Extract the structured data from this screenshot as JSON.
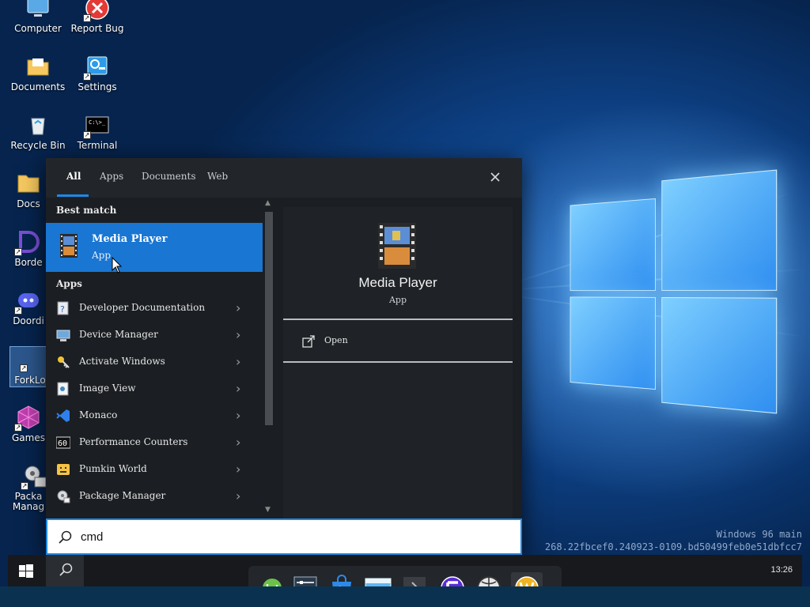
{
  "desktop": {
    "icons": [
      {
        "label": "Computer",
        "icon": "computer-icon"
      },
      {
        "label": "Report Bug",
        "icon": "report-bug-icon"
      },
      {
        "label": "Documents",
        "icon": "documents-folder-icon"
      },
      {
        "label": "Settings",
        "icon": "settings-icon"
      },
      {
        "label": "Recycle Bin",
        "icon": "recycle-bin-icon"
      },
      {
        "label": "Terminal",
        "icon": "terminal-icon"
      },
      {
        "label": "Docs",
        "icon": "docs-folder-icon"
      },
      {
        "label": "Borde",
        "icon": "border-app-icon"
      },
      {
        "label": "Doordi",
        "icon": "discord-icon"
      },
      {
        "label": "ForkLo",
        "icon": "forklore-icon"
      },
      {
        "label": "Games",
        "icon": "games-icon"
      },
      {
        "label": "Packa Manag",
        "icon": "package-manager-icon"
      }
    ],
    "watermark_line1": "Windows 96 main",
    "watermark_line2": "268.22fbcef0.240923-0109.bd50499feb0e51dbfcc7"
  },
  "start_menu": {
    "tabs": [
      {
        "label": "All",
        "active": true
      },
      {
        "label": "Apps",
        "active": false
      },
      {
        "label": "Documents",
        "active": false
      },
      {
        "label": "Web",
        "active": false
      }
    ],
    "close_icon": "close-icon",
    "best_match_header": "Best match",
    "best_match": {
      "name": "Media Player",
      "type": "App",
      "icon": "media-player-icon"
    },
    "apps_header": "Apps",
    "apps": [
      {
        "label": "Developer Documentation",
        "icon": "help-document-icon"
      },
      {
        "label": "Device Manager",
        "icon": "device-manager-icon"
      },
      {
        "label": "Activate Windows",
        "icon": "activate-key-icon"
      },
      {
        "label": "Image View",
        "icon": "image-view-icon"
      },
      {
        "label": "Monaco",
        "icon": "code-editor-icon"
      },
      {
        "label": "Performance Counters",
        "icon": "performance-counter-icon"
      },
      {
        "label": "Pumkin World",
        "icon": "pumpkin-icon"
      },
      {
        "label": "Package Manager",
        "icon": "package-gear-icon"
      }
    ],
    "preview": {
      "name": "Media Player",
      "type": "App",
      "action_open": "Open"
    },
    "search": {
      "value": "cmd",
      "icon": "search-icon"
    }
  },
  "taskbar": {
    "clock": "13:26",
    "dock_items": [
      {
        "name": "linux-mint-icon",
        "color": "#6cc04a"
      },
      {
        "name": "control-panel-icon",
        "color": "#9fb4c8"
      },
      {
        "name": "app-store-icon",
        "color": "#2d8ae8"
      },
      {
        "name": "file-explorer-icon",
        "color": "#5fb6f0"
      },
      {
        "name": "terminal-dock-icon",
        "color": "#3a3d41"
      },
      {
        "name": "f-app-icon",
        "color": "#5b2bd4"
      },
      {
        "name": "web-browser-icon",
        "color": "#cfcfcf"
      },
      {
        "name": "w-app-icon",
        "color": "#f0b323"
      }
    ]
  }
}
